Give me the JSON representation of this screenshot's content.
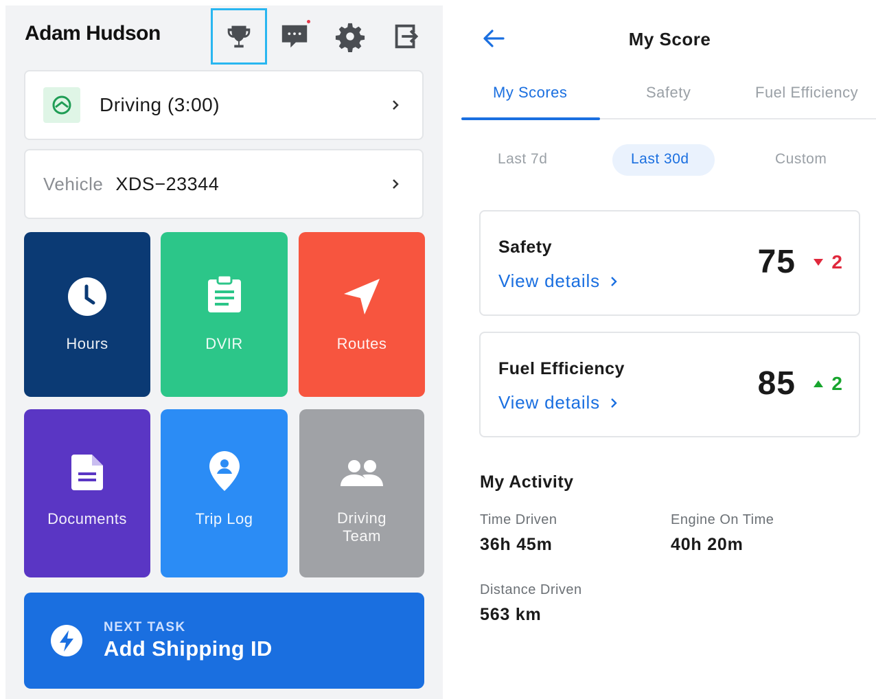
{
  "left": {
    "user_name": "Adam Hudson",
    "header_icons": [
      {
        "name": "trophy-icon",
        "selected": true
      },
      {
        "name": "messages-icon",
        "has_notification": true
      },
      {
        "name": "gear-icon"
      },
      {
        "name": "logout-icon"
      }
    ],
    "status_label": "Driving (3:00)",
    "vehicle_label": "Vehicle",
    "vehicle_value": "XDS−23344",
    "tiles": [
      {
        "label": "Hours",
        "icon": "clock-icon",
        "color": "#0b3a74"
      },
      {
        "label": "DVIR",
        "icon": "clipboard-icon",
        "color": "#2cc689"
      },
      {
        "label": "Routes",
        "icon": "navigation-arrow-icon",
        "color": "#f7553f"
      },
      {
        "label": "Documents",
        "icon": "document-icon",
        "color": "#5a36c4"
      },
      {
        "label": "Trip Log",
        "icon": "location-pin-icon",
        "color": "#2b8cf5"
      },
      {
        "label_line1": "Driving",
        "label_line2": "Team",
        "icon": "people-icon",
        "color": "#a0a2a6"
      }
    ],
    "next_task_kicker": "NEXT TASK",
    "next_task_title": "Add Shipping ID"
  },
  "right": {
    "title": "My Score",
    "tabs": [
      "My Scores",
      "Safety",
      "Fuel Efficiency"
    ],
    "active_tab": 0,
    "ranges": [
      "Last 7d",
      "Last 30d",
      "Custom"
    ],
    "active_range": 1,
    "scores": [
      {
        "title": "Safety",
        "link": "View details",
        "value": "75",
        "delta": "2",
        "direction": "down",
        "delta_color": "#e0283c"
      },
      {
        "title": "Fuel Efficiency",
        "link": "View details",
        "value": "85",
        "delta": "2",
        "direction": "up",
        "delta_color": "#18a52e"
      }
    ],
    "activity_title": "My Activity",
    "activity": [
      {
        "label": "Time Driven",
        "value": "36h 45m"
      },
      {
        "label": "Engine On Time",
        "value": "40h 20m"
      },
      {
        "label": "Distance Driven",
        "value": "563 km"
      }
    ]
  }
}
